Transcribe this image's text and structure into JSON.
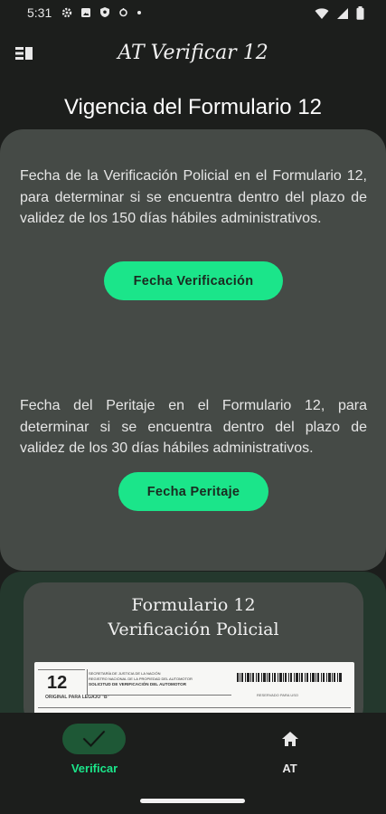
{
  "status": {
    "time": "5:31"
  },
  "app": {
    "title": "AT Verificar 12"
  },
  "page": {
    "title": "Vigencia del Formulario 12"
  },
  "sections": [
    {
      "text": "Fecha de la Verificación Policial en el Formulario 12, para determinar si se encuentra dentro del plazo de validez de los 150 días hábiles administrativos.",
      "button_label": "Fecha Verificación"
    },
    {
      "text": "Fecha del Peritaje en el Formulario 12, para determinar si se encuentra dentro del plazo de validez de los 30 días hábiles administrativos.",
      "button_label": "Fecha Peritaje"
    }
  ],
  "form_card": {
    "title_line1": "Formulario 12",
    "title_line2": "Verificación Policial",
    "doc_number": "12",
    "doc_copy": "ORIGINAL PARA LEGAJO \"B\"",
    "doc_ministry": "SECRETARÍA DE JUSTICIA DE LA NACIÓN",
    "doc_registry": "REGISTRO NACIONAL DE LA PROPIEDAD DEL AUTOMOTOR",
    "doc_request": "SOLICITUD DE VERIFICACIÓN DEL AUTOMOTOR",
    "doc_reserved": "RESERVADO PARA USO"
  },
  "nav": {
    "items": [
      {
        "label": "Verificar",
        "icon": "check-icon",
        "active": true
      },
      {
        "label": "AT",
        "icon": "home-icon",
        "active": false
      }
    ]
  },
  "colors": {
    "accent": "#1be58a",
    "background": "#1c1e1c",
    "card": "#454a46",
    "nav_active_pill": "#1e5836",
    "second_section_bg": "#24382d"
  }
}
